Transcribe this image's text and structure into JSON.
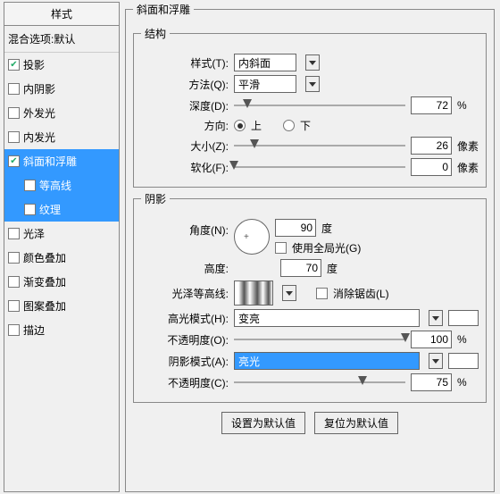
{
  "sidebar": {
    "title": "样式",
    "blend": "混合选项:默认",
    "items": [
      {
        "label": "投影",
        "checked": true,
        "selected": false,
        "indent": false
      },
      {
        "label": "内阴影",
        "checked": false,
        "selected": false,
        "indent": false
      },
      {
        "label": "外发光",
        "checked": false,
        "selected": false,
        "indent": false
      },
      {
        "label": "内发光",
        "checked": false,
        "selected": false,
        "indent": false
      },
      {
        "label": "斜面和浮雕",
        "checked": true,
        "selected": true,
        "indent": false
      },
      {
        "label": "等高线",
        "checked": false,
        "selected": true,
        "indent": true
      },
      {
        "label": "纹理",
        "checked": false,
        "selected": true,
        "indent": true
      },
      {
        "label": "光泽",
        "checked": false,
        "selected": false,
        "indent": false
      },
      {
        "label": "颜色叠加",
        "checked": false,
        "selected": false,
        "indent": false
      },
      {
        "label": "渐变叠加",
        "checked": false,
        "selected": false,
        "indent": false
      },
      {
        "label": "图案叠加",
        "checked": false,
        "selected": false,
        "indent": false
      },
      {
        "label": "描边",
        "checked": false,
        "selected": false,
        "indent": false
      }
    ]
  },
  "panel_title": "斜面和浮雕",
  "structure": {
    "legend": "结构",
    "style_label": "样式(T):",
    "style_value": "内斜面",
    "method_label": "方法(Q):",
    "method_value": "平滑",
    "depth_label": "深度(D):",
    "depth_value": "72",
    "depth_unit": "%",
    "direction_label": "方向:",
    "up": "上",
    "down": "下",
    "size_label": "大小(Z):",
    "size_value": "26",
    "size_unit": "像素",
    "soften_label": "软化(F):",
    "soften_value": "0",
    "soften_unit": "像素"
  },
  "shading": {
    "legend": "阴影",
    "angle_label": "角度(N):",
    "angle_value": "90",
    "angle_unit": "度",
    "global_label": "使用全局光(G)",
    "altitude_label": "高度:",
    "altitude_value": "70",
    "altitude_unit": "度",
    "gloss_label": "光泽等高线:",
    "antialias_label": "消除锯齿(L)",
    "highlight_mode_label": "高光模式(H):",
    "highlight_mode_value": "变亮",
    "highlight_opacity_label": "不透明度(O):",
    "highlight_opacity_value": "100",
    "highlight_opacity_unit": "%",
    "shadow_mode_label": "阴影模式(A):",
    "shadow_mode_value": "亮光",
    "shadow_opacity_label": "不透明度(C):",
    "shadow_opacity_value": "75",
    "shadow_opacity_unit": "%"
  },
  "footer": {
    "default": "设置为默认值",
    "reset": "复位为默认值"
  }
}
